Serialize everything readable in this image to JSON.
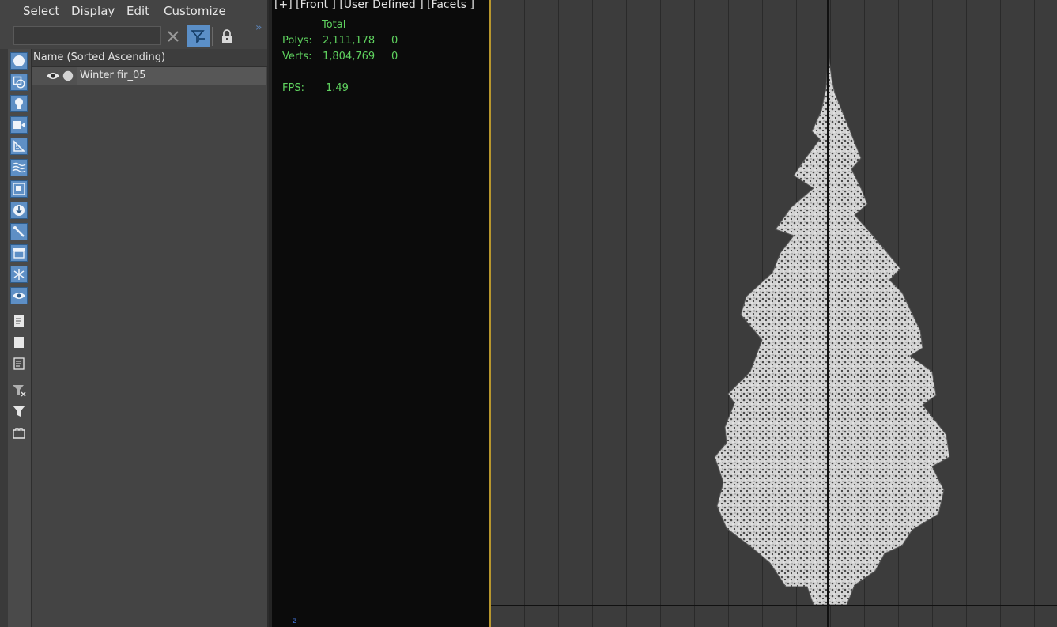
{
  "menu": {
    "items": [
      "Select",
      "Display",
      "Edit",
      "Customize"
    ]
  },
  "toolbar": {
    "search_value": "",
    "search_placeholder": "",
    "more_label": "»"
  },
  "list": {
    "column_header": "Name (Sorted Ascending)",
    "rows": [
      {
        "name": "Winter fir_05"
      }
    ]
  },
  "side_icons": [
    "geometry-icon",
    "shapes-icon",
    "lights-icon",
    "cameras-icon",
    "helpers-icon",
    "space-warps-icon",
    "groups-icon",
    "xrefs-icon",
    "bones-icon",
    "containers-icon",
    "frozen-icon",
    "hidden-icon",
    "display-all-icon",
    "display-none-icon",
    "invert-icon",
    "filter-clear-icon",
    "filter-icon",
    "layers-icon"
  ],
  "viewport": {
    "label": "[+] [Front ] [User Defined ] [Facets ]",
    "stats": {
      "total_header": "Total",
      "polys_label": "Polys:",
      "polys_value": "2,111,178",
      "polys_sel": "0",
      "verts_label": "Verts:",
      "verts_value": "1,804,769",
      "verts_sel": "0",
      "fps_label": "FPS:",
      "fps_value": "1.49"
    },
    "axis_label": "z"
  },
  "colors": {
    "accent_blue": "#5e8fc5",
    "stats_green": "#5fd25f",
    "active_border": "#b8972e"
  }
}
